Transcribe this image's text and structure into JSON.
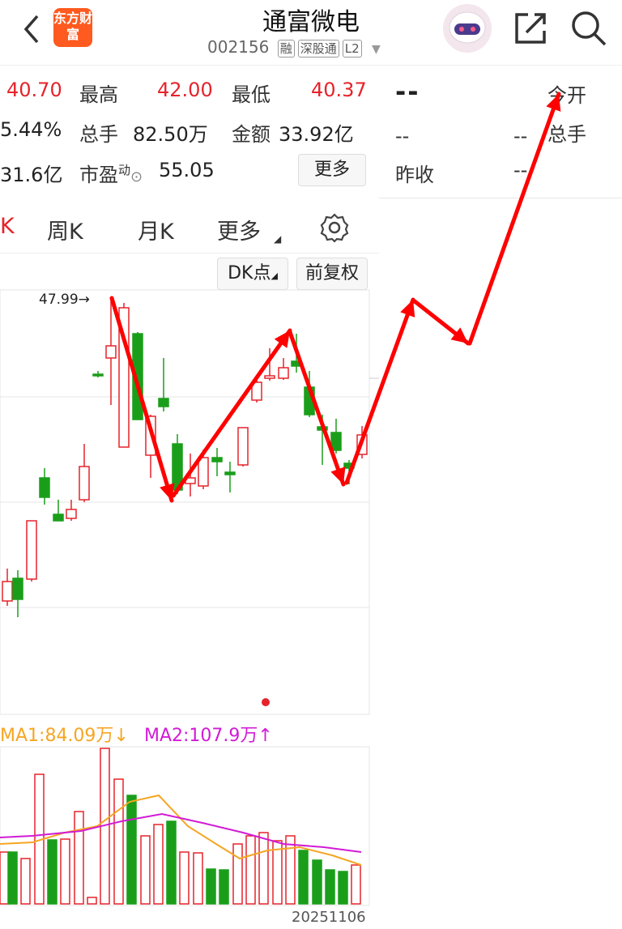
{
  "header": {
    "title": "通富微电",
    "code": "002156",
    "tags": [
      "融",
      "深股通",
      "L2"
    ],
    "logo_text": "东方财富"
  },
  "quote": {
    "row1": {
      "v0": "40.70",
      "high_label": "最高",
      "high": "42.00",
      "low_label": "最低",
      "low": "40.37"
    },
    "row2": {
      "v0": "5.44%",
      "vol_label": "总手",
      "vol": "82.50万",
      "amt_label": "金额",
      "amt": "33.92亿"
    },
    "row3": {
      "v0": "31.6亿",
      "pe_label": "市盈",
      "pe_sup": "动",
      "pe": "55.05",
      "more": "更多"
    }
  },
  "right_panel": {
    "main_dash": "--",
    "today_open": "今开",
    "dash1": "--",
    "dash2": "--",
    "vol_label": "总手",
    "prev_close": "昨收",
    "dash3": "--"
  },
  "tabs": {
    "week": "周K",
    "month": "月K",
    "more": "更多"
  },
  "chart_controls": {
    "dk": "DK点",
    "fq": "前复权"
  },
  "chart_data": {
    "type": "candlestick",
    "max_label": "47.99",
    "date_label": "20251106",
    "ma1": "MA1:84.09万",
    "ma1_arrow": "↓",
    "ma2": "MA2:107.9万",
    "ma2_arrow": "↑",
    "colors": {
      "up": "#e5232b",
      "down": "#1a9e1a",
      "ma1": "#f5a623",
      "ma2": "#d21bd6",
      "arrow": "#f00"
    }
  }
}
